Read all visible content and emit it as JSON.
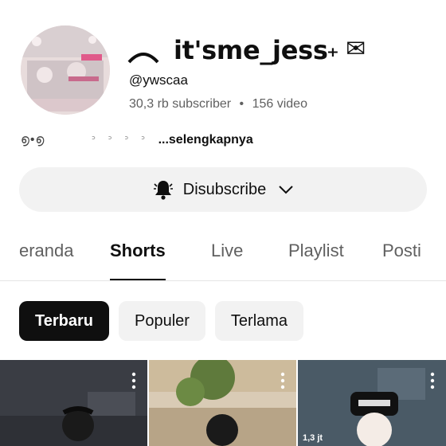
{
  "channel": {
    "title": "it'sme_jess",
    "title_deco_right": "₊ ✉",
    "handle": "@ywscaa",
    "subscribers": "30,3 rb subscriber",
    "separator": "•",
    "videos": "156 video",
    "description_symbols": "൭•൭",
    "description_faded": "ᐣ ᐣ ᐣ ᐣ",
    "description_more": "...selengkapnya"
  },
  "subscribe": {
    "label": "Disubscribe",
    "icon": "bell-icon",
    "dropdown_icon": "chevron-down-icon"
  },
  "tabs": [
    {
      "label": "eranda",
      "active": false
    },
    {
      "label": "Shorts",
      "active": true
    },
    {
      "label": "Live",
      "active": false
    },
    {
      "label": "Playlist",
      "active": false
    },
    {
      "label": "Posti",
      "active": false
    }
  ],
  "filters": [
    {
      "label": "Terbaru",
      "active": true
    },
    {
      "label": "Populer",
      "active": false
    },
    {
      "label": "Terlama",
      "active": false
    }
  ],
  "shorts": [
    {
      "views": ""
    },
    {
      "views": ""
    },
    {
      "views": "1,3 jt"
    }
  ],
  "colors": {
    "accent_dark": "#0f0f0f",
    "chip_bg": "#f2f2f2",
    "secondary_text": "#606060"
  }
}
